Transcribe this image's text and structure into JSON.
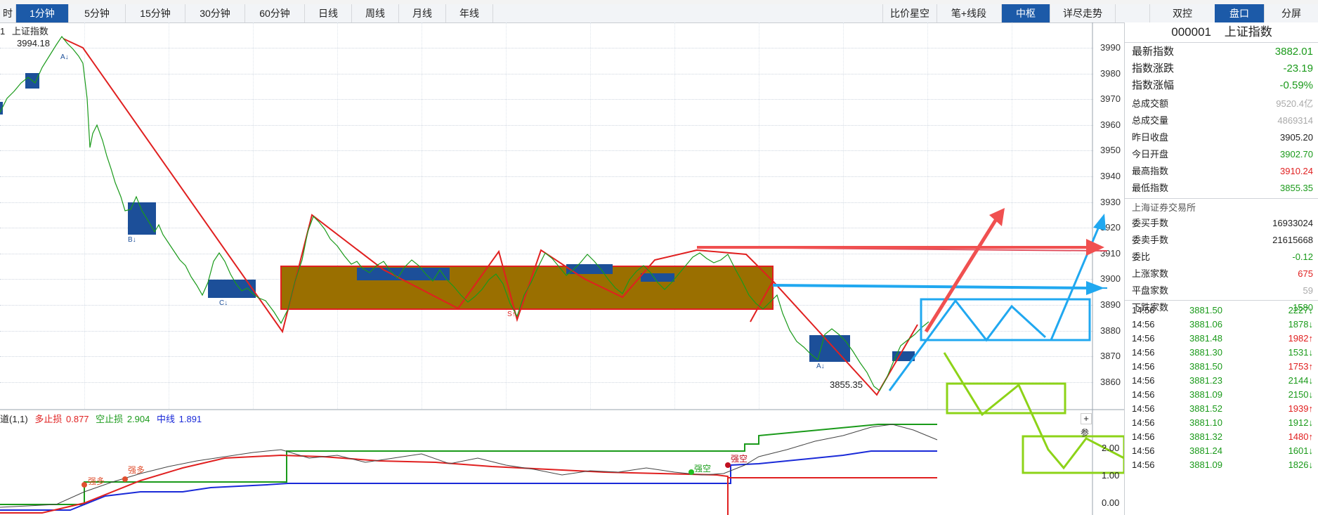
{
  "toolbar": {
    "periods": [
      "1分钟",
      "5分钟",
      "15分钟",
      "30分钟",
      "60分钟",
      "日线",
      "周线",
      "月线",
      "年线"
    ],
    "active_period": "1分钟",
    "left_cut": "时",
    "tools": [
      "比价星空",
      "笔+线段",
      "中枢",
      "详尽走势"
    ],
    "active_tool": "中枢"
  },
  "right_toolbar": {
    "items": [
      "双控",
      "盘口",
      "分屏"
    ],
    "active": "盘口"
  },
  "chart": {
    "title_prefix": "1",
    "title": "上证指数",
    "high_label": "3994.18",
    "low_label": "3855.35",
    "y_ticks": [
      "3990",
      "3980",
      "3970",
      "3960",
      "3950",
      "3940",
      "3930",
      "3920",
      "3910",
      "3900",
      "3890",
      "3880",
      "3870",
      "3860"
    ],
    "marks": {
      "A": "A",
      "B": "B",
      "C": "C",
      "S": "S"
    }
  },
  "indicator": {
    "name": "道(1,1)",
    "long_stop_label": "多止损",
    "long_stop_value": "0.877",
    "short_stop_label": "空止损",
    "short_stop_value": "2.904",
    "mid_label": "中线",
    "mid_value": "1.891",
    "y_ticks": [
      "2.00",
      "1.00",
      "0.00"
    ],
    "plus": "+",
    "param": "参",
    "annotations": [
      "强多",
      "强多",
      "强空",
      "强空"
    ]
  },
  "quote": {
    "code": "000001",
    "name": "上证指数",
    "rows_big": [
      {
        "label": "最新指数",
        "value": "3882.01",
        "color": "#1a9a1a"
      },
      {
        "label": "指数涨跌",
        "value": "-23.19",
        "color": "#1a9a1a"
      },
      {
        "label": "指数涨幅",
        "value": "-0.59%",
        "color": "#1a9a1a"
      }
    ],
    "rows_small": [
      {
        "label": "总成交额",
        "value": "9520.4亿",
        "color": "#aaaaaa"
      },
      {
        "label": "总成交量",
        "value": "4869314",
        "color": "#aaaaaa"
      },
      {
        "label": "昨日收盘",
        "value": "3905.20",
        "color": "#222222"
      },
      {
        "label": "今日开盘",
        "value": "3902.70",
        "color": "#1a9a1a"
      },
      {
        "label": "最高指数",
        "value": "3910.24",
        "color": "#e02020"
      },
      {
        "label": "最低指数",
        "value": "3855.35",
        "color": "#1a9a1a"
      }
    ],
    "exchange": "上海证券交易所",
    "rows_ex": [
      {
        "label": "委买手数",
        "value": "16933024",
        "color": "#222222"
      },
      {
        "label": "委卖手数",
        "value": "21615668",
        "color": "#222222"
      },
      {
        "label": "委比",
        "value": "-0.12",
        "color": "#1a9a1a"
      },
      {
        "label": "上涨家数",
        "value": "675",
        "color": "#e02020"
      },
      {
        "label": "平盘家数",
        "value": "59",
        "color": "#aaaaaa"
      },
      {
        "label": "下跌家数",
        "value": "1580",
        "color": "#1a9a1a"
      }
    ],
    "ticks": [
      {
        "time": "14:56",
        "price": "3881.50",
        "vol": "2227↓",
        "vcolor": "#1a9a1a"
      },
      {
        "time": "14:56",
        "price": "3881.06",
        "vol": "1878↓",
        "vcolor": "#1a9a1a"
      },
      {
        "time": "14:56",
        "price": "3881.48",
        "vol": "1982↑",
        "vcolor": "#e02020"
      },
      {
        "time": "14:56",
        "price": "3881.30",
        "vol": "1531↓",
        "vcolor": "#1a9a1a"
      },
      {
        "time": "14:56",
        "price": "3881.50",
        "vol": "1753↑",
        "vcolor": "#e02020"
      },
      {
        "time": "14:56",
        "price": "3881.23",
        "vol": "2144↓",
        "vcolor": "#1a9a1a"
      },
      {
        "time": "14:56",
        "price": "3881.09",
        "vol": "2150↓",
        "vcolor": "#1a9a1a"
      },
      {
        "time": "14:56",
        "price": "3881.52",
        "vol": "1939↑",
        "vcolor": "#e02020"
      },
      {
        "time": "14:56",
        "price": "3881.10",
        "vol": "1912↓",
        "vcolor": "#1a9a1a"
      },
      {
        "time": "14:56",
        "price": "3881.32",
        "vol": "1480↑",
        "vcolor": "#e02020"
      },
      {
        "time": "14:56",
        "price": "3881.24",
        "vol": "1601↓",
        "vcolor": "#1a9a1a"
      },
      {
        "time": "14:56",
        "price": "3881.09",
        "vol": "1826↓",
        "vcolor": "#1a9a1a"
      }
    ]
  }
}
